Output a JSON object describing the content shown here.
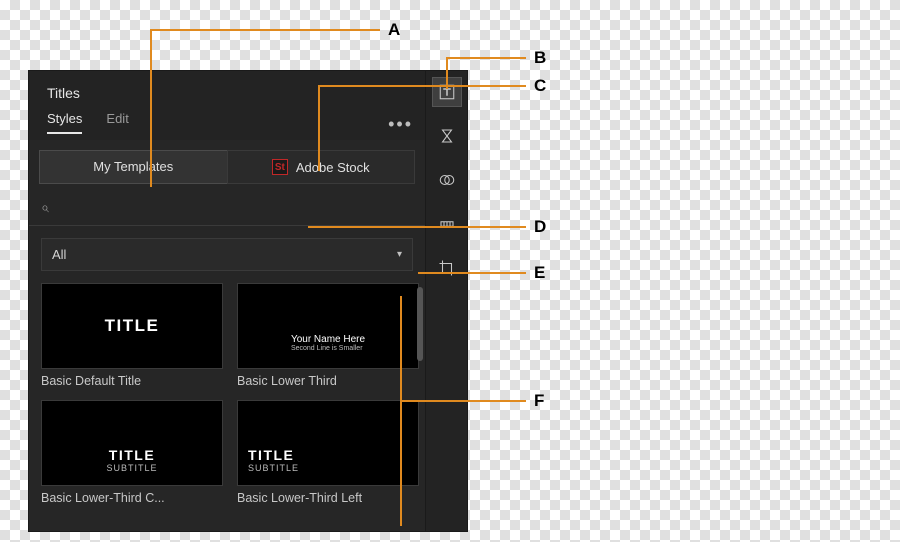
{
  "panel": {
    "title": "Titles",
    "tabs": {
      "active": "Styles",
      "inactive": "Edit"
    },
    "sources": {
      "my_templates": "My Templates",
      "adobe_stock": "Adobe Stock"
    },
    "search": {
      "placeholder": ""
    },
    "filter": {
      "label": "All"
    },
    "templates": [
      {
        "name": "Basic Default Title",
        "preview": {
          "lines": [
            "TITLE"
          ],
          "style": "center-big"
        }
      },
      {
        "name": "Basic Lower Third",
        "preview": {
          "lines": [
            "Your Name Here",
            "Second Line is Smaller"
          ],
          "style": "lower-small"
        }
      },
      {
        "name": "Basic Lower-Third C...",
        "preview": {
          "lines": [
            "TITLE",
            "SUBTITLE"
          ],
          "style": "lower-center"
        }
      },
      {
        "name": "Basic Lower-Third Left",
        "preview": {
          "lines": [
            "TITLE",
            "SUBTITLE"
          ],
          "style": "lower-left"
        }
      }
    ],
    "sidebar_icons": [
      "text-tool-icon",
      "hourglass-icon",
      "venn-icon",
      "level-icon",
      "crop-icon"
    ]
  },
  "callouts": {
    "A": "A",
    "B": "B",
    "C": "C",
    "D": "D",
    "E": "E",
    "F": "F"
  }
}
